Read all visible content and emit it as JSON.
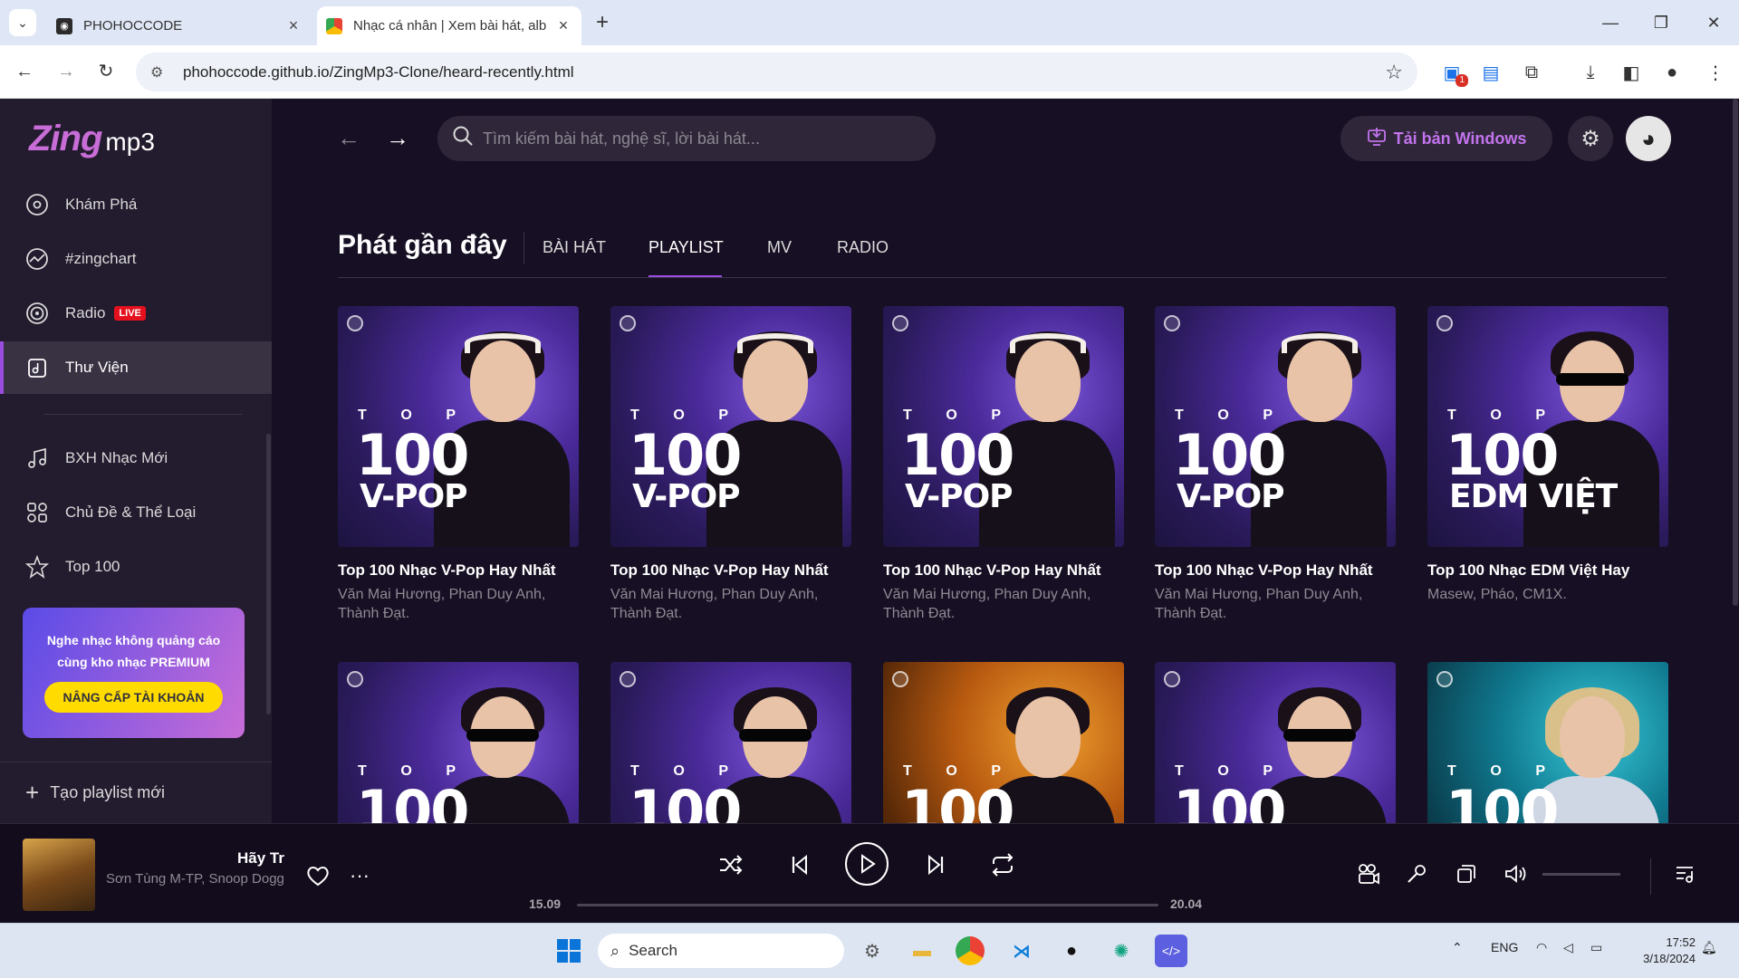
{
  "browser": {
    "tabs": [
      {
        "title": "PHOHOCCODE",
        "active": false
      },
      {
        "title": "Nhạc cá nhân | Xem bài hát, alb",
        "active": true
      }
    ],
    "url": "phohoccode.github.io/ZingMp3-Clone/heard-recently.html",
    "extension_badge": "1"
  },
  "app": {
    "logo": {
      "brand": "Zing",
      "suffix": "mp3"
    },
    "sidebar": {
      "main_items": [
        {
          "label": "Khám Phá",
          "icon": "disc-icon"
        },
        {
          "label": "#zingchart",
          "icon": "chart-icon"
        },
        {
          "label": "Radio",
          "icon": "radio-icon",
          "badge": "LIVE"
        },
        {
          "label": "Thư Viện",
          "icon": "library-icon",
          "active": true
        }
      ],
      "secondary_items": [
        {
          "label": "BXH Nhạc Mới",
          "icon": "music-note-icon"
        },
        {
          "label": "Chủ Đề & Thể Loại",
          "icon": "category-icon"
        },
        {
          "label": "Top 100",
          "icon": "star-icon"
        }
      ],
      "promo": {
        "text_line1": "Nghe nhạc không quảng cáo",
        "text_line2": "cùng kho nhạc PREMIUM",
        "button": "NÂNG CẤP TÀI KHOẢN"
      },
      "new_playlist": "Tạo playlist mới"
    },
    "header": {
      "search_placeholder": "Tìm kiếm bài hát, nghệ sĩ, lời bài hát...",
      "download_label": "Tải bản Windows"
    },
    "page": {
      "title": "Phát gần đây",
      "tabs": [
        {
          "label": "BÀI HÁT",
          "active": false
        },
        {
          "label": "PLAYLIST",
          "active": true
        },
        {
          "label": "MV",
          "active": false
        },
        {
          "label": "RADIO",
          "active": false
        }
      ]
    },
    "playlists": [
      {
        "title": "Top 100 Nhạc V-Pop Hay Nhất",
        "artists": "Văn Mai Hương, Phan Duy Anh, Thành Đạt.",
        "cover_top": "T O P",
        "cover_number": "100",
        "cover_genre": "V-POP",
        "theme": "purple"
      },
      {
        "title": "Top 100 Nhạc V-Pop Hay Nhất",
        "artists": "Văn Mai Hương, Phan Duy Anh, Thành Đạt.",
        "cover_top": "T O P",
        "cover_number": "100",
        "cover_genre": "V-POP",
        "theme": "purple"
      },
      {
        "title": "Top 100 Nhạc V-Pop Hay Nhất",
        "artists": "Văn Mai Hương, Phan Duy Anh, Thành Đạt.",
        "cover_top": "T O P",
        "cover_number": "100",
        "cover_genre": "V-POP",
        "theme": "purple"
      },
      {
        "title": "Top 100 Nhạc V-Pop Hay Nhất",
        "artists": "Văn Mai Hương, Phan Duy Anh, Thành Đạt.",
        "cover_top": "T O P",
        "cover_number": "100",
        "cover_genre": "V-POP",
        "theme": "purple"
      },
      {
        "title": "Top 100 Nhạc EDM Việt Hay",
        "artists": "Masew, Pháo, CM1X.",
        "cover_top": "T O P",
        "cover_number": "100",
        "cover_genre": "EDM VIỆT",
        "theme": "purple"
      },
      {
        "title": "",
        "artists": "",
        "cover_top": "T O P",
        "cover_number": "100",
        "cover_genre": "",
        "theme": "purple"
      },
      {
        "title": "",
        "artists": "",
        "cover_top": "T O P",
        "cover_number": "100",
        "cover_genre": "",
        "theme": "purple"
      },
      {
        "title": "",
        "artists": "",
        "cover_top": "T O P",
        "cover_number": "100",
        "cover_genre": "",
        "theme": "orange"
      },
      {
        "title": "",
        "artists": "",
        "cover_top": "T O P",
        "cover_number": "100",
        "cover_genre": "",
        "theme": "purple"
      },
      {
        "title": "",
        "artists": "",
        "cover_top": "T O P",
        "cover_number": "100",
        "cover_genre": "",
        "theme": "teal"
      }
    ],
    "player": {
      "song_title": "Hãy Tr",
      "song_artist": "Sơn Tùng M-TP, Snoop Dogg",
      "time_current": "15.09",
      "time_total": "20.04",
      "progress_fraction": 0.0
    }
  },
  "taskbar": {
    "search": "Search",
    "language": "ENG",
    "time": "17:52",
    "date": "3/18/2024"
  },
  "colors": {
    "accent": "#9b4de0",
    "app_bg": "#170f23",
    "sidebar_bg": "#231b2e",
    "download_text": "#c273ed",
    "upgrade_button": "#ffdb00",
    "live_badge": "#e5101d"
  }
}
